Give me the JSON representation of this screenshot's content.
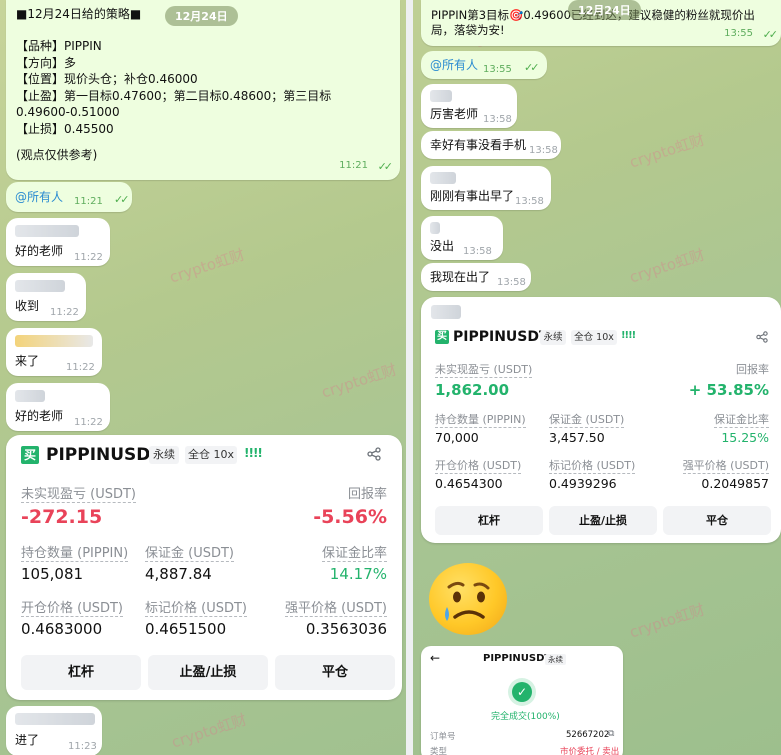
{
  "left": {
    "date": "12月24日",
    "strategy": {
      "title": "■12月24日给的策略■",
      "lines": [
        "【品种】PIPPIN",
        "【方向】多",
        "【位置】现价头仓；补仓0.46000",
        "【止盈】第一目标0.47600；第二目标0.48600；第三目标",
        "0.49600-0.51000",
        "【止损】0.45500",
        "",
        "(观点仅供参考)"
      ],
      "time": "11:21"
    },
    "mention": {
      "text": "@所有人",
      "time": "11:21"
    },
    "messages": [
      {
        "text": "好的老师",
        "time": "11:22"
      },
      {
        "text": "收到",
        "time": "11:22"
      },
      {
        "text": "来了",
        "time": "11:22"
      },
      {
        "text": "好的老师",
        "time": "11:22"
      }
    ],
    "last": {
      "text": "进了",
      "time": "11:23"
    },
    "card": {
      "side": "买",
      "symbol": "PIPPINUSDT",
      "type": "永续",
      "margin": "全仓 10x",
      "bars": "!!!!",
      "pnl_label": "未实现盈亏 (USDT)",
      "pnl_value": "-272.15",
      "roi_label": "回报率",
      "roi_value": "-5.56%",
      "qty_label": "持仓数量 (PIPPIN)",
      "qty_value": "105,081",
      "margin_label": "保证金 (USDT)",
      "margin_value": "4,887.84",
      "ratio_label": "保证金比率",
      "ratio_value": "14.17%",
      "entry_label": "开仓价格 (USDT)",
      "entry_value": "0.4683000",
      "mark_label": "标记价格 (USDT)",
      "mark_value": "0.4651500",
      "liq_label": "强平价格 (USDT)",
      "liq_value": "0.3563036",
      "btn_leverage": "杠杆",
      "btn_tpsl": "止盈/止损",
      "btn_close": "平仓"
    }
  },
  "right": {
    "date": "12月24日",
    "announce": {
      "text": "PIPPIN第3目标🎯0.49600已经到达，建议稳健的粉丝就现价出局，落袋为安!",
      "time": "13:55"
    },
    "mention": {
      "text": "@所有人",
      "time": "13:55"
    },
    "messages": [
      {
        "text": "厉害老师",
        "time": "13:58"
      },
      {
        "text": "幸好有事没看手机",
        "time": "13:58"
      },
      {
        "text": "刚刚有事出早了",
        "time": "13:58"
      },
      {
        "text": "没出",
        "time": "13:58"
      },
      {
        "text": "我现在出了",
        "time": "13:58"
      }
    ],
    "card": {
      "side": "买",
      "symbol": "PIPPINUSDT",
      "type": "永续",
      "margin": "全仓 10x",
      "bars": "!!!!",
      "pnl_label": "未实现盈亏 (USDT)",
      "pnl_value": "1,862.00",
      "roi_label": "回报率",
      "roi_value": "+ 53.85%",
      "qty_label": "持仓数量 (PIPPIN)",
      "qty_value": "70,000",
      "margin_label": "保证金 (USDT)",
      "margin_value": "3,457.50",
      "ratio_label": "保证金比率",
      "ratio_value": "15.25%",
      "entry_label": "开仓价格 (USDT)",
      "entry_value": "0.4654300",
      "mark_label": "标记价格 (USDT)",
      "mark_value": "0.4939296",
      "liq_label": "强平价格 (USDT)",
      "liq_value": "0.2049857",
      "btn_leverage": "杠杆",
      "btn_tpsl": "止盈/止损",
      "btn_close": "平仓"
    },
    "order": {
      "symbol": "PIPPINUSDT",
      "type": "永续",
      "status": "完全成交(100%)",
      "order_no_label": "订单号",
      "order_no": "52667202",
      "kind_label": "类型",
      "kind_value": "市价委托 / 卖出"
    }
  },
  "watermark": "crypto虹财",
  "colors": {
    "positive": "#23b36c",
    "negative": "#e94359",
    "link": "#2a8bd1"
  }
}
